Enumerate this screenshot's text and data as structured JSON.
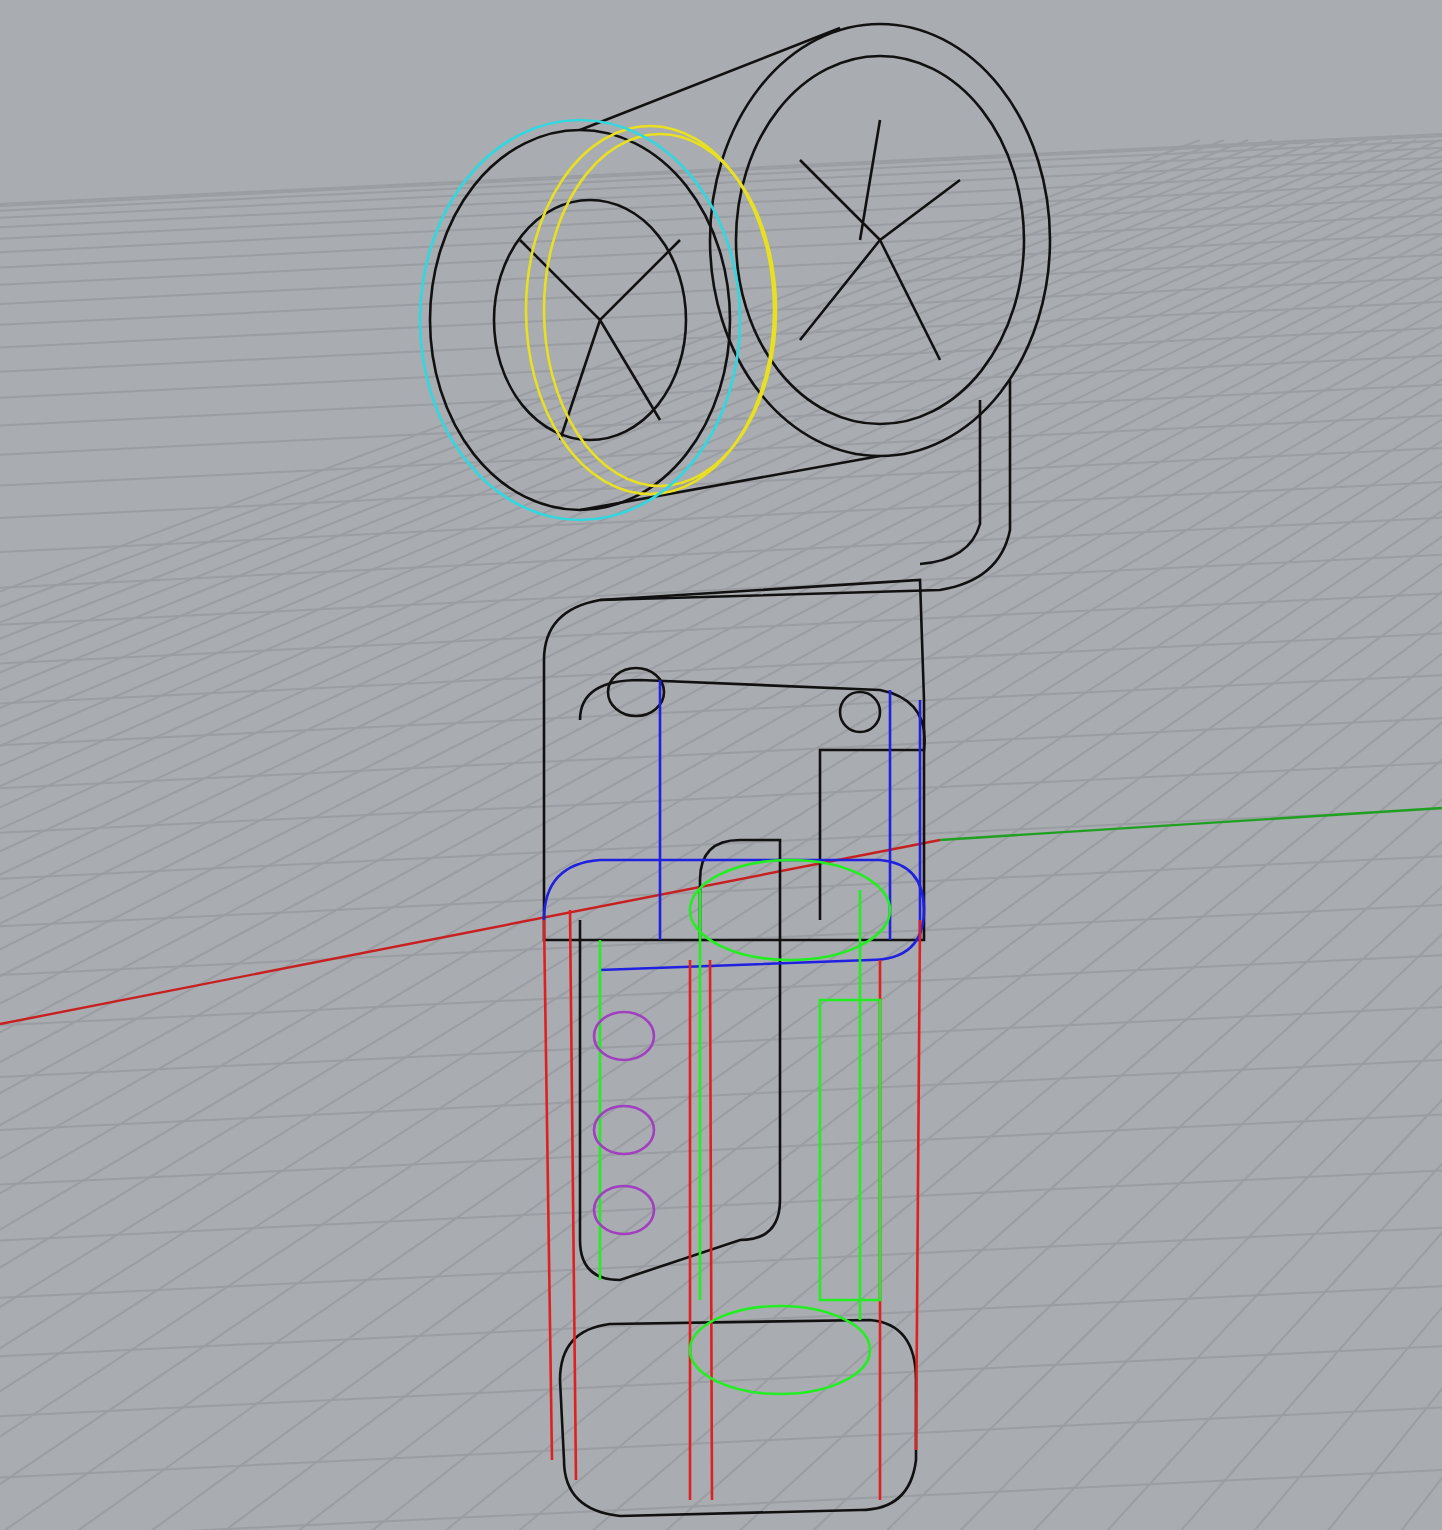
{
  "viewport": {
    "axes": [
      {
        "color": "#c82020"
      },
      {
        "color": "#20a020"
      }
    ]
  }
}
